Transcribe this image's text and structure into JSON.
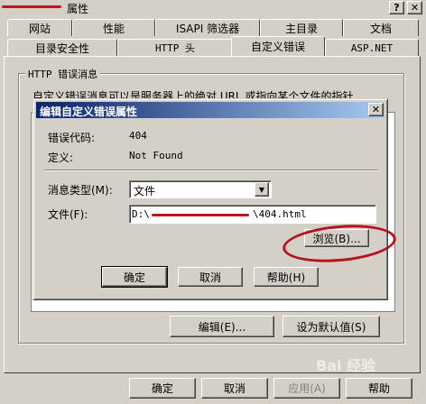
{
  "window": {
    "title": "属性",
    "help_btn": "?",
    "close_btn": "✕"
  },
  "tabs_row1": [
    "网站",
    "性能",
    "ISAPI 筛选器",
    "主目录",
    "文档"
  ],
  "tabs_row2": [
    "目录安全性",
    "HTTP 头",
    "自定义错误",
    "ASP.NET"
  ],
  "group": {
    "label": "HTTP 错误消息",
    "description": "自定义错误消息可以是服务器上的绝对 URL 或指向某个文件的指针"
  },
  "page_buttons": {
    "edit": "编辑(E)...",
    "set_default": "设为默认值(S)"
  },
  "footer_buttons": {
    "ok": "确定",
    "cancel": "取消",
    "apply": "应用(A)",
    "help": "帮助"
  },
  "dialog": {
    "title": "编辑自定义错误属性",
    "close_btn": "✕",
    "error_code_label": "错误代码:",
    "error_code_value": "404",
    "definition_label": "定义:",
    "definition_value": "Not Found",
    "msg_type_label": "消息类型(M):",
    "msg_type_value": "文件",
    "file_label": "文件(F):",
    "file_value_start": "D:\\",
    "file_value_end": "\\404.html",
    "browse_btn": "浏览(B)...",
    "ok_btn": "确定",
    "cancel_btn": "取消",
    "help_btn": "帮助(H)"
  },
  "annotation_color": "#b5121b",
  "watermark": "Bai 经验"
}
